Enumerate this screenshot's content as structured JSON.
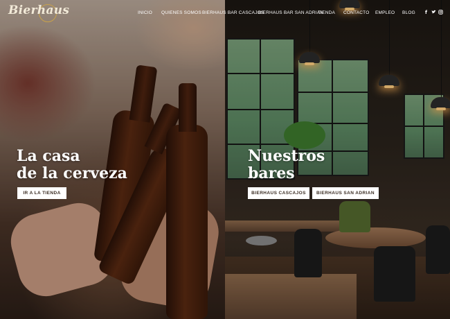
{
  "brand": {
    "logo_text": "Bierhaus"
  },
  "nav": {
    "items": [
      {
        "label": "INICIO"
      },
      {
        "label": "QUIENES SOMOS"
      },
      {
        "label": "BIERHAUS BAR CASCAJOS"
      },
      {
        "label": "BIERHAUS BAR SAN ADRIAN"
      },
      {
        "label": "TIENDA"
      },
      {
        "label": "CONTACTO"
      },
      {
        "label": "EMPLEO"
      },
      {
        "label": "BLOG"
      }
    ],
    "social": [
      {
        "icon": "facebook-icon",
        "glyph": "f"
      },
      {
        "icon": "twitter-icon",
        "glyph": "🐦"
      },
      {
        "icon": "instagram-icon",
        "glyph": "◎"
      }
    ]
  },
  "left_panel": {
    "title_line1": "La casa",
    "title_line2": "de la cerveza",
    "button_label": "IR A LA TIENDA"
  },
  "right_panel": {
    "title_line1": "Nuestros",
    "title_line2": "bares",
    "button1_label": "BIERHAUS CASCAJOS",
    "button2_label": "BIERHAUS SAN ADRIAN"
  },
  "colors": {
    "button_bg": "#ffffff",
    "button_text": "#3a2c22",
    "logo_accent": "#c9a24a"
  }
}
